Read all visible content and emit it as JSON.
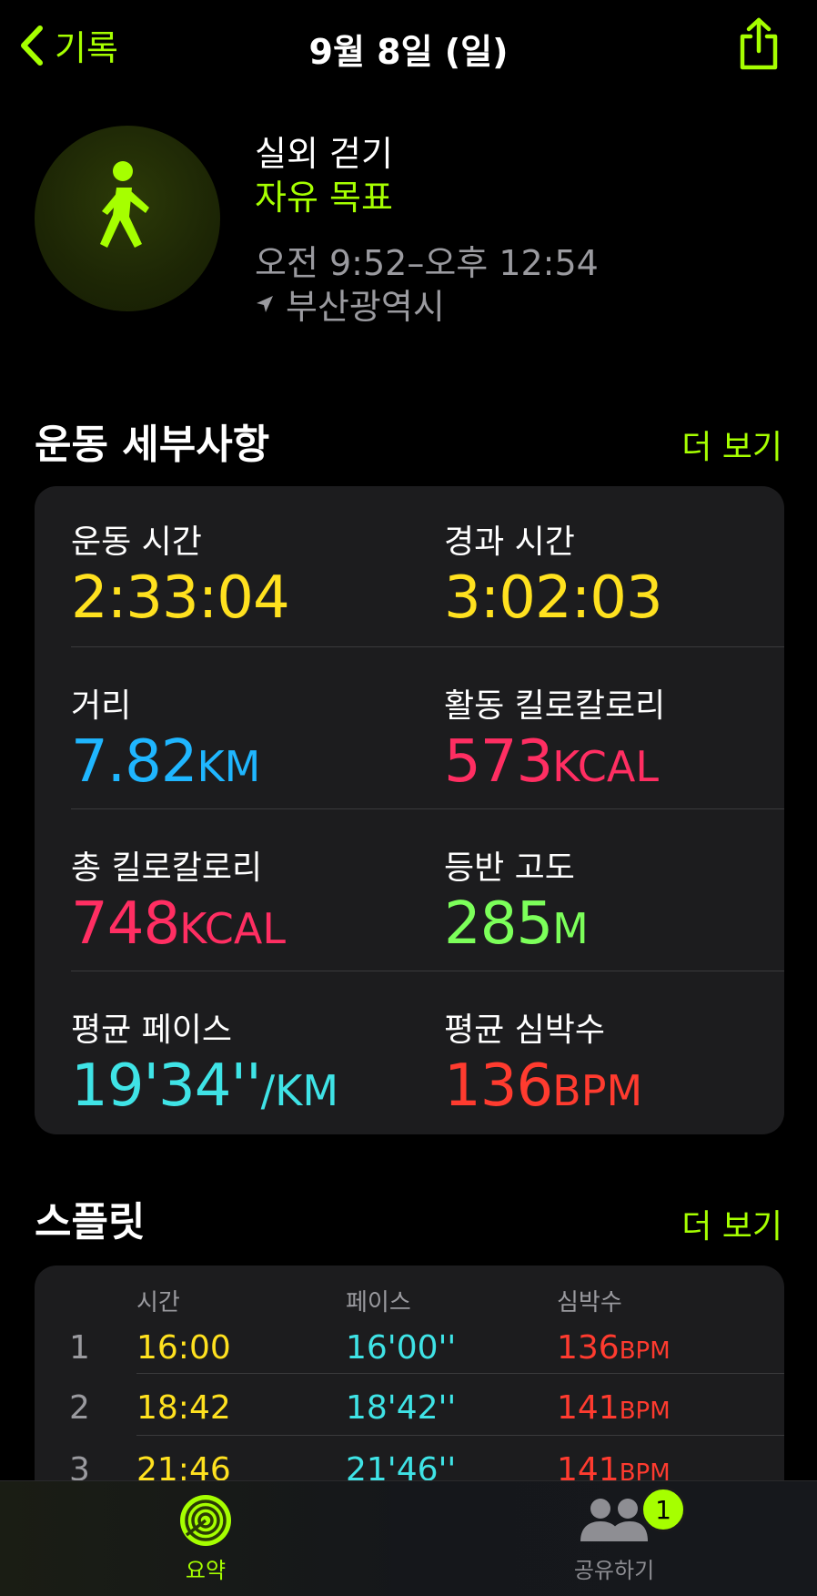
{
  "nav": {
    "back_label": "기록",
    "title": "9월 8일 (일)"
  },
  "header": {
    "activity": "실외 걷기",
    "goal": "자유 목표",
    "time_range": "오전 9:52–오후 12:54",
    "location": "부산광역시"
  },
  "details": {
    "title": "운동 세부사항",
    "more": "더 보기",
    "metrics": [
      {
        "label": "운동 시간",
        "value": "2:33:04",
        "unit": "",
        "color": "#ffe11f"
      },
      {
        "label": "경과 시간",
        "value": "3:02:03",
        "unit": "",
        "color": "#ffe11f"
      },
      {
        "label": "거리",
        "value": "7.82",
        "unit": "KM",
        "color": "#1fb6ff"
      },
      {
        "label": "활동 킬로칼로리",
        "value": "573",
        "unit": "KCAL",
        "color": "#ff2e62"
      },
      {
        "label": "총 킬로칼로리",
        "value": "748",
        "unit": "KCAL",
        "color": "#ff2e62"
      },
      {
        "label": "등반 고도",
        "value": "285",
        "unit": "M",
        "color": "#7cff5a"
      },
      {
        "label": "평균 페이스",
        "value": "19'34''",
        "unit": "/KM",
        "color": "#3fe3e6"
      },
      {
        "label": "평균 심박수",
        "value": "136",
        "unit": "BPM",
        "color": "#ff3b2f"
      }
    ]
  },
  "splits": {
    "title": "스플릿",
    "more": "더 보기",
    "headers": {
      "time": "시간",
      "pace": "페이스",
      "hr": "심박수"
    },
    "hr_unit": "BPM",
    "rows": [
      {
        "n": "1",
        "time": "16:00",
        "pace": "16'00''",
        "hr": "136"
      },
      {
        "n": "2",
        "time": "18:42",
        "pace": "18'42''",
        "hr": "141"
      },
      {
        "n": "3",
        "time": "21:46",
        "pace": "21'46''",
        "hr": "141"
      }
    ]
  },
  "tabbar": {
    "summary_label": "요약",
    "sharing_label": "공유하기",
    "sharing_badge": "1"
  },
  "colors": {
    "accent": "#a6ff00",
    "yellow": "#ffe11f",
    "cyan": "#3fe3e6",
    "red": "#ff3b2f"
  }
}
